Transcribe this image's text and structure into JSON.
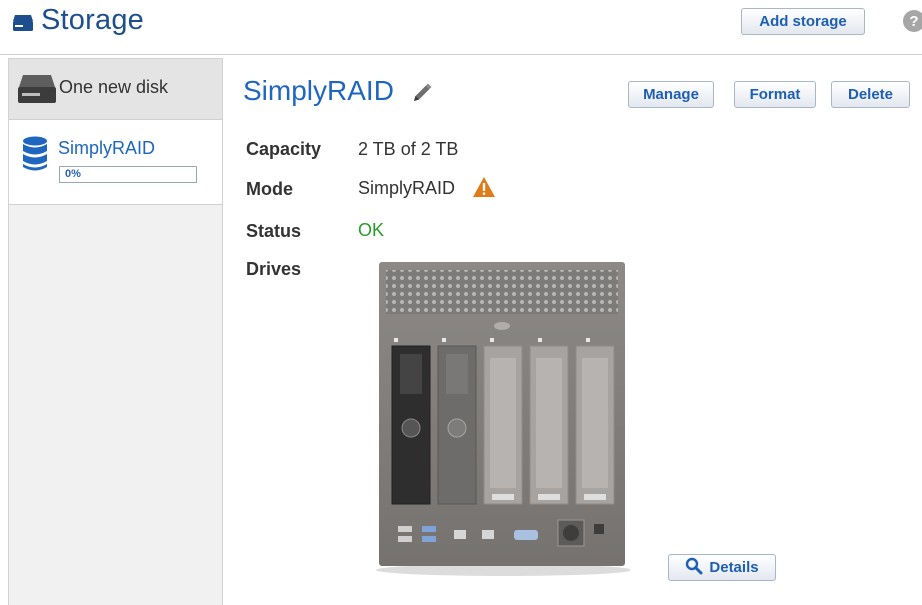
{
  "header": {
    "title": "Storage",
    "add_storage_label": "Add storage",
    "help_label": "?"
  },
  "sidebar": {
    "items": [
      {
        "label": "One new disk",
        "icon": "disk-drive-icon"
      },
      {
        "label": "SimplyRAID",
        "icon": "database-icon",
        "progress_label": "0%",
        "progress": 0
      }
    ]
  },
  "main": {
    "volume_name": "SimplyRAID",
    "actions": {
      "manage": "Manage",
      "format": "Format",
      "delete": "Delete"
    },
    "properties": {
      "capacity_label": "Capacity",
      "capacity_value": "2 TB of 2 TB",
      "mode_label": "Mode",
      "mode_value": "SimplyRAID",
      "status_label": "Status",
      "status_value": "OK",
      "drives_label": "Drives"
    },
    "details_label": "Details"
  },
  "colors": {
    "title_blue": "#1d4f8f",
    "link_blue": "#1e66c0",
    "status_ok": "#2a9a2a",
    "warning": "#e07b1a"
  }
}
